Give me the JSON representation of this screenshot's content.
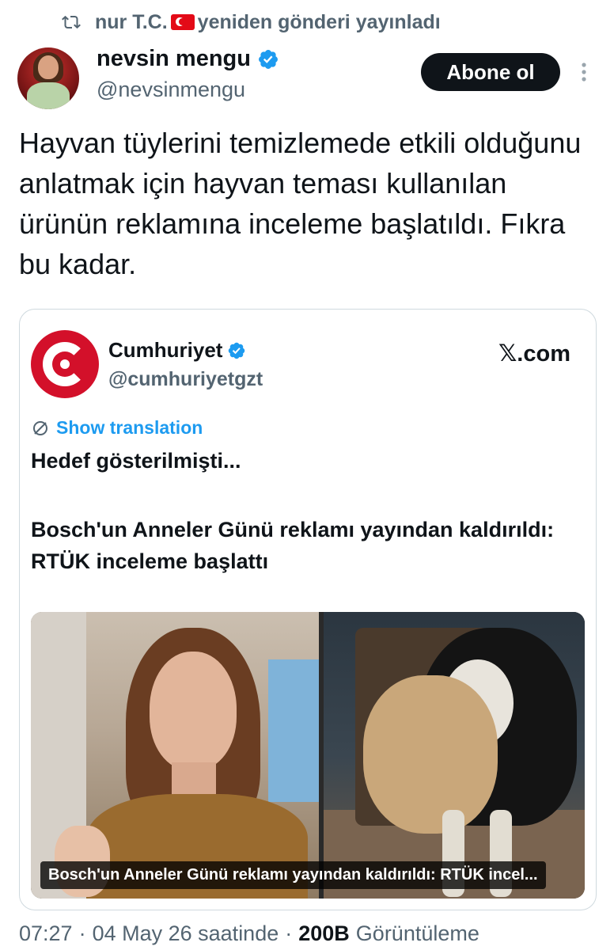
{
  "repost": {
    "user": "nur T.C.",
    "label": "yeniden gönderi yayınladı",
    "icon": "repost-icon",
    "flag_icon": "turkey-flag-icon"
  },
  "author": {
    "name": "nevsin mengu",
    "handle": "@nevsinmengu",
    "verified": true,
    "verified_color": "#1d9bf0"
  },
  "follow_button": {
    "label": "Abone ol"
  },
  "more_icon": "more-vertical-icon",
  "tweet": {
    "text": "Hayvan tüylerini temizlemede etkili olduğunu anlatmak için hayvan teması kullanılan ürünün reklamına inceleme başlatıldı. Fıkra bu kadar."
  },
  "quoted": {
    "name": "Cumhuriyet",
    "handle": "@cumhuriyetgzt",
    "verified": true,
    "site": "𝕏.com",
    "translate_label": "Show translation",
    "headline1": "Hedef gösterilmişti...",
    "headline2": "Bosch'un Anneler Günü reklamı yayından kaldırıldı: RTÜK inceleme başlattı",
    "media_caption": "Bosch'un Anneler Günü reklamı yayından kaldırıldı: RTÜK incel...",
    "brand_color": "#d3102a"
  },
  "meta": {
    "time": "07:27",
    "date": "04 May 26 saatinde",
    "views_count": "200B",
    "views_label": "Görüntüleme",
    "separator": "·"
  }
}
